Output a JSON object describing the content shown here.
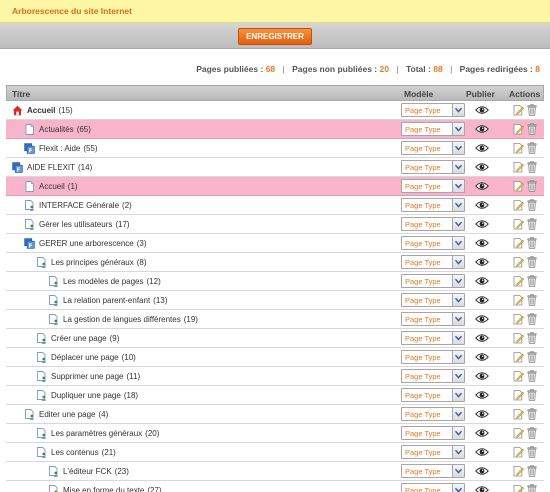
{
  "window": {
    "title": "Arborescence du site Internet"
  },
  "toolbar": {
    "save_label": "ENREGISTRER"
  },
  "stats": {
    "published_label": "Pages publiées :",
    "published_value": "68",
    "unpublished_label": "Pages non publiées :",
    "unpublished_value": "20",
    "total_label": "Total :",
    "total_value": "88",
    "redirected_label": "Pages redirigées :",
    "redirected_value": "8",
    "separator": "|"
  },
  "table": {
    "headers": {
      "title": "Titre",
      "model": "Modèle",
      "publish": "Publier",
      "actions": "Actions"
    },
    "select_value": "Page Type",
    "rows": [
      {
        "label": "Accueil",
        "count": "(15)",
        "level": 0,
        "icon": "home-icon",
        "highlight": false,
        "bold": true
      },
      {
        "label": "Actualités",
        "count": "(65)",
        "level": 1,
        "icon": "page-icon",
        "highlight": true,
        "bold": false
      },
      {
        "label": "Flexit : Aide",
        "count": "(55)",
        "level": 1,
        "icon": "app-icon",
        "highlight": false,
        "bold": false
      },
      {
        "label": "AIDE FLEXIT",
        "count": "(14)",
        "level": 0,
        "icon": "app-icon",
        "highlight": false,
        "bold": false
      },
      {
        "label": "Accueil",
        "count": "(1)",
        "level": 1,
        "icon": "page-icon",
        "highlight": true,
        "bold": false
      },
      {
        "label": "INTERFACE Générale",
        "count": "(2)",
        "level": 1,
        "icon": "page-user-icon",
        "highlight": false,
        "bold": false
      },
      {
        "label": "Gérer les utilisateurs",
        "count": "(17)",
        "level": 1,
        "icon": "page-user-icon",
        "highlight": false,
        "bold": false
      },
      {
        "label": "GERER une arborescence",
        "count": "(3)",
        "level": 1,
        "icon": "app-icon",
        "highlight": false,
        "bold": false
      },
      {
        "label": "Les principes généraux",
        "count": "(8)",
        "level": 2,
        "icon": "page-user-icon",
        "highlight": false,
        "bold": false
      },
      {
        "label": "Les modèles de pages",
        "count": "(12)",
        "level": 3,
        "icon": "page-user-icon",
        "highlight": false,
        "bold": false
      },
      {
        "label": "La relation parent-enfant",
        "count": "(13)",
        "level": 3,
        "icon": "page-user-icon",
        "highlight": false,
        "bold": false
      },
      {
        "label": "La gestion de langues différentes",
        "count": "(19)",
        "level": 3,
        "icon": "page-user-icon",
        "highlight": false,
        "bold": false
      },
      {
        "label": "Créer une page",
        "count": "(9)",
        "level": 2,
        "icon": "page-user-icon",
        "highlight": false,
        "bold": false
      },
      {
        "label": "Déplacer une page",
        "count": "(10)",
        "level": 2,
        "icon": "page-user-icon",
        "highlight": false,
        "bold": false
      },
      {
        "label": "Supprimer une page",
        "count": "(11)",
        "level": 2,
        "icon": "page-user-icon",
        "highlight": false,
        "bold": false
      },
      {
        "label": "Dupliquer une page",
        "count": "(18)",
        "level": 2,
        "icon": "page-user-icon",
        "highlight": false,
        "bold": false
      },
      {
        "label": "Editer une page",
        "count": "(4)",
        "level": 1,
        "icon": "page-user-icon",
        "highlight": false,
        "bold": false
      },
      {
        "label": "Les paramètres généraux",
        "count": "(20)",
        "level": 2,
        "icon": "page-user-icon",
        "highlight": false,
        "bold": false
      },
      {
        "label": "Les contenus",
        "count": "(21)",
        "level": 2,
        "icon": "page-user-icon",
        "highlight": false,
        "bold": false
      },
      {
        "label": "L'éditeur FCK",
        "count": "(23)",
        "level": 3,
        "icon": "page-user-icon",
        "highlight": false,
        "bold": false
      },
      {
        "label": "Mise en forme du texte",
        "count": "(27)",
        "level": 3,
        "icon": "page-user-icon",
        "highlight": false,
        "bold": false
      }
    ]
  },
  "colors": {
    "accent": "#e2691a",
    "highlight_row": "#f7b4cb",
    "title_bar": "#fdf7a6"
  }
}
